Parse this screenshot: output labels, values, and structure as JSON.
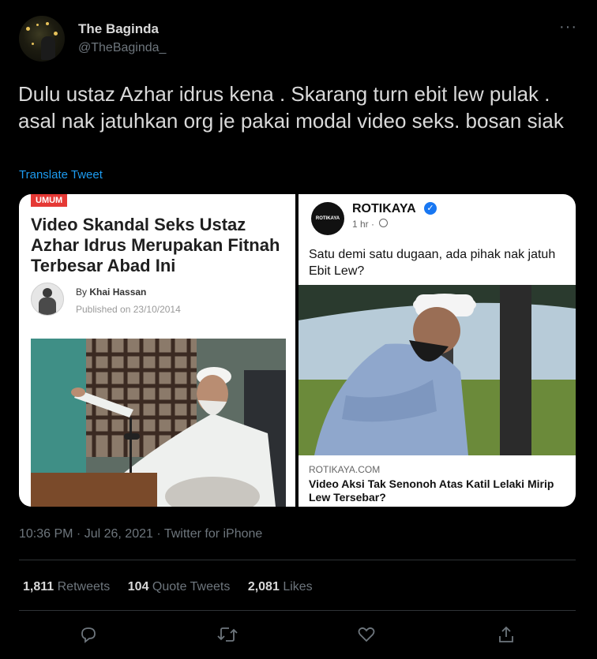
{
  "user": {
    "name": "The Baginda",
    "handle": "@TheBaginda_"
  },
  "tweet": {
    "text": "Dulu ustaz Azhar idrus kena . Skarang turn ebit lew pulak . asal nak jatuhkan org je pakai modal video seks. bosan siak",
    "translate_label": "Translate Tweet",
    "timestamp": "10:36 PM · Jul 26, 2021 · Twitter for iPhone"
  },
  "media": {
    "left": {
      "tag": "UMUM",
      "title": "Video Skandal Seks Ustaz Azhar Idrus Merupakan Fitnah Terbesar Abad Ini",
      "by_prefix": "By",
      "author": "Khai Hassan",
      "published": "Published on 23/10/2014"
    },
    "right": {
      "logo_text": "ROTIKAYA",
      "page_name": "ROTIKAYA",
      "time": "1 hr ·",
      "caption_line1": "Satu demi satu dugaan, ada pihak nak jatuh",
      "caption_line2": "Ebit Lew?",
      "link_domain": "ROTIKAYA.COM",
      "link_title_line1": "Video Aksi Tak Senonoh Atas Katil Lelaki Mirip",
      "link_title_line2": "Lew Tersebar?"
    }
  },
  "stats": {
    "retweets_count": "1,811",
    "retweets_label": "Retweets",
    "quotes_count": "104",
    "quotes_label": "Quote Tweets",
    "likes_count": "2,081",
    "likes_label": "Likes"
  },
  "icons": {
    "reply": "reply-icon",
    "retweet": "retweet-icon",
    "like": "heart-icon",
    "share": "share-icon",
    "more": "more-icon"
  },
  "colors": {
    "background": "#000000",
    "text": "#d9d9d9",
    "muted": "#6e767d",
    "link": "#1d9bf0",
    "divider": "#2f3336",
    "tag": "#e53935",
    "verified": "#1877f2"
  }
}
